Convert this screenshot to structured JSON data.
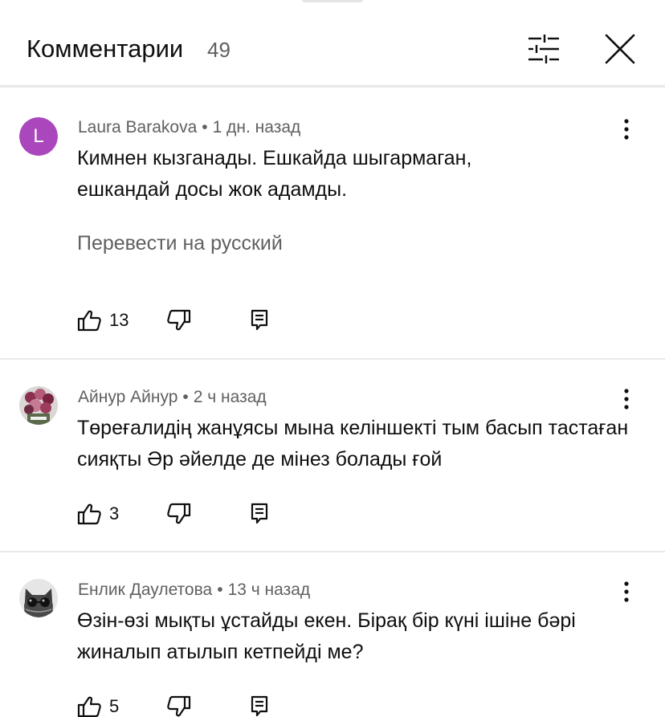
{
  "header": {
    "title": "Комментарии",
    "count": "49",
    "filter_icon": "sort-filter-icon",
    "close_icon": "close-icon"
  },
  "comments": [
    {
      "author": "Laura Barakova",
      "separator": "•",
      "time": "1 дн. назад",
      "avatar_letter": "L",
      "avatar_color": "#ab47bc",
      "text": "Кимнен кызганады. Ешкайда шыгармаган, ешкандай досы жок адамды.",
      "translate_label": "Перевести на русский",
      "likes": "13"
    },
    {
      "author": "Айнур Айнур",
      "separator": "•",
      "time": "2 ч назад",
      "avatar_icon": "flower-bouquet-avatar",
      "text": "Төреғалидің жанұясы мына келіншекті тым басып тастаған сияқты Әр әйелде де мінез болады ғой",
      "likes": "3"
    },
    {
      "author": "Енлик Даулетова",
      "separator": "•",
      "time": "13 ч назад",
      "avatar_icon": "cat-with-sunglasses-avatar",
      "text": "Өзін-өзі мықты ұстайды екен. Бірақ бір күні ішіне бәрі жиналып атылып кетпейді ме?",
      "likes": "5"
    }
  ]
}
